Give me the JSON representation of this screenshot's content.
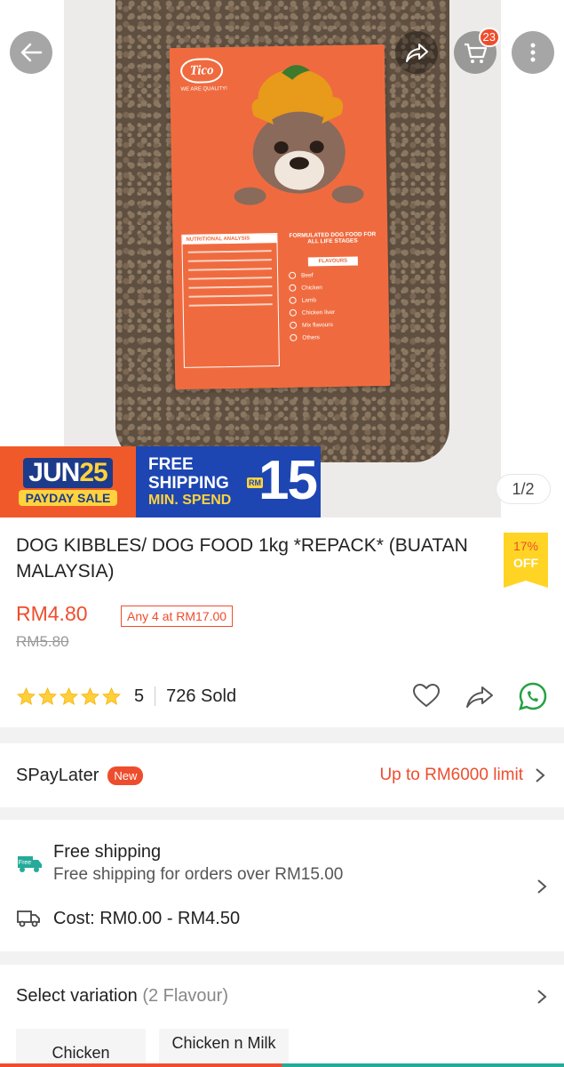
{
  "header": {
    "cart_count": "23",
    "image_pager": "1/2"
  },
  "hero_label": {
    "brand": "Tico",
    "tagline": "WE ARE QUALITY!",
    "nutrition_heading": "NUTRITIONAL ANALYSIS",
    "formula_heading": "FORMULATED DOG FOOD FOR ALL LIFE STAGES",
    "flavours_heading": "FLAVOURS",
    "flavours": [
      "Beef",
      "Chicken",
      "Lamb",
      "Chicken liver",
      "Mix flavours",
      "Others"
    ]
  },
  "promo": {
    "month": "JUN",
    "day": "25",
    "sale_label": "PAYDAY SALE",
    "shipping_line1": "FREE",
    "shipping_line2": "SHIPPING",
    "min_spend": "MIN. SPEND",
    "currency": "RM",
    "amount": "15"
  },
  "product": {
    "title": "DOG KIBBLES/ DOG FOOD 1kg *REPACK* (BUATAN MALAYSIA)",
    "discount_percent": "17%",
    "discount_word": "OFF",
    "price": "RM4.80",
    "bundle_deal": "Any 4 at RM17.00",
    "original_price": "RM5.80",
    "rating": "5",
    "rating_stars": 5,
    "sold": "726 Sold"
  },
  "spaylater": {
    "label": "SPayLater",
    "badge": "New",
    "limit": "Up to RM6000 limit"
  },
  "shipping": {
    "badge": "Free",
    "title": "Free shipping",
    "subtitle": "Free shipping for orders over RM15.00",
    "cost": "Cost: RM0.00 - RM4.50"
  },
  "variation": {
    "title": "Select variation",
    "count": "(2 Flavour)",
    "options": [
      "Chicken",
      "Chicken n Milk"
    ]
  },
  "colors": {
    "accent": "#ee4d2d",
    "badge_yellow": "#ffd424",
    "whatsapp": "#25a244"
  }
}
